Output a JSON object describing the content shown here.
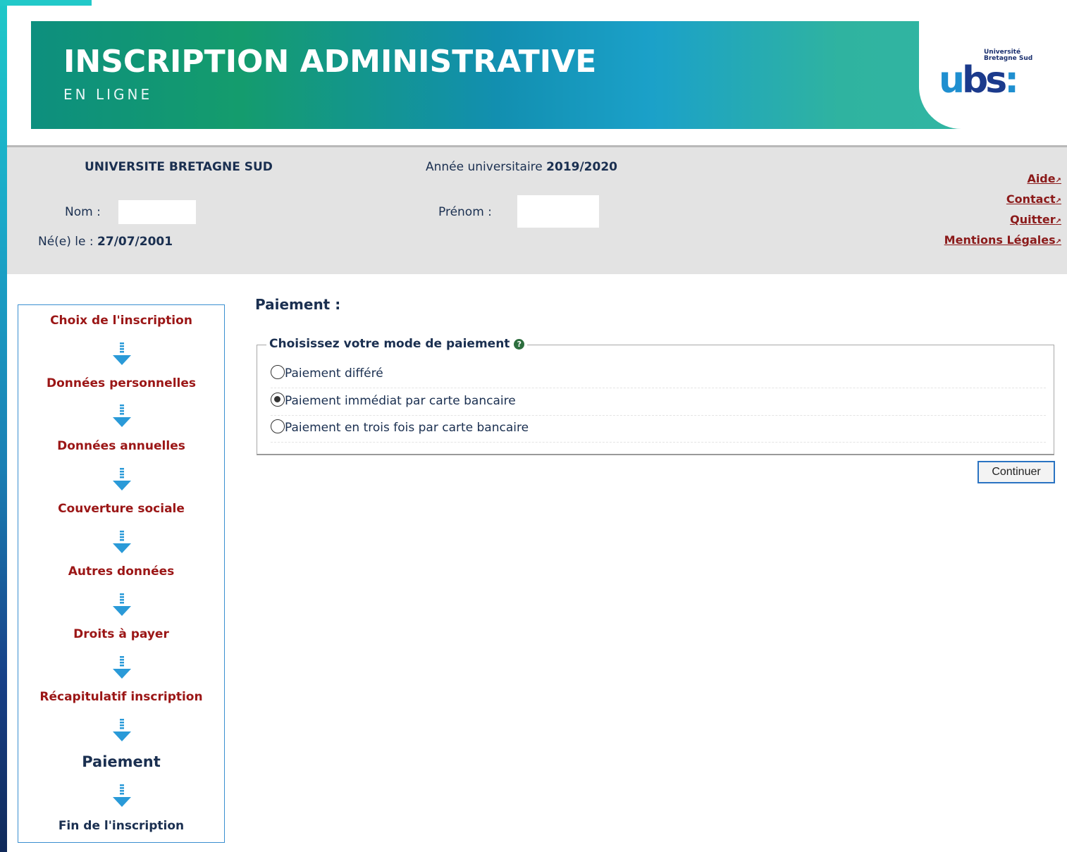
{
  "banner": {
    "title": "INSCRIPTION ADMINISTRATIVE",
    "subtitle": "EN LIGNE",
    "logo_text": "Université Bretagne Sud",
    "logo_mark": "UBS"
  },
  "info": {
    "university": "UNIVERSITE BRETAGNE SUD",
    "year_label": "Année universitaire",
    "year_value": "2019/2020",
    "nom_label": "Nom :",
    "nom_value": "",
    "prenom_label": "Prénom :",
    "prenom_value": "",
    "dob_label": "Né(e) le :",
    "dob_value": "27/07/2001"
  },
  "links": [
    "Aide",
    "Contact",
    "Quitter",
    "Mentions Légales"
  ],
  "steps": [
    {
      "label": "Choix de l'inscription",
      "state": "done"
    },
    {
      "label": "Données personnelles",
      "state": "done"
    },
    {
      "label": "Données annuelles",
      "state": "done"
    },
    {
      "label": "Couverture sociale",
      "state": "done"
    },
    {
      "label": "Autres données",
      "state": "done"
    },
    {
      "label": "Droits à payer",
      "state": "done"
    },
    {
      "label": "Récapitulatif inscription",
      "state": "done"
    },
    {
      "label": "Paiement",
      "state": "current"
    },
    {
      "label": "Fin de l'inscription",
      "state": "next"
    }
  ],
  "main": {
    "title": "Paiement :",
    "legend": "Choisissez votre mode de paiement",
    "help_icon": "?",
    "options": [
      {
        "label": "Paiement différé",
        "selected": false
      },
      {
        "label": "Paiement immédiat par carte bancaire",
        "selected": true
      },
      {
        "label": "Paiement en trois fois par carte bancaire",
        "selected": false
      }
    ],
    "continue_label": "Continuer"
  },
  "colors": {
    "step_done": "#9b1616",
    "step_current": "#1a2f50",
    "arrow": "#2a9ad8",
    "link": "#8b1a1a"
  }
}
